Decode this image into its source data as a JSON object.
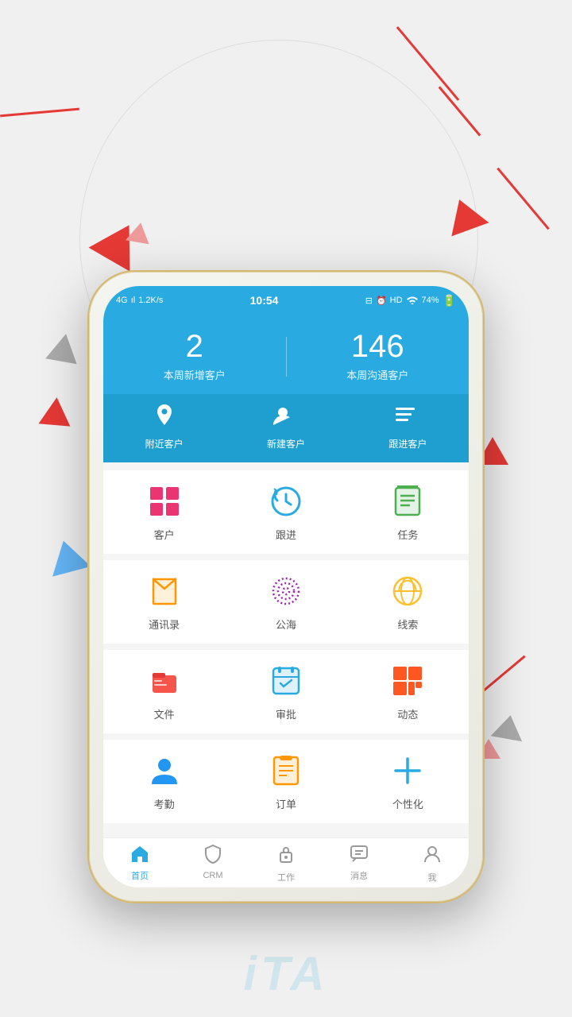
{
  "background": {
    "color": "#f0f0f0"
  },
  "status_bar": {
    "network": "4G",
    "signal": "ıl",
    "speed": "1.2K/s",
    "time": "10:54",
    "battery_icon": "□",
    "alarm": "⏰",
    "hd": "HD",
    "wifi": "wifi",
    "battery_pct": "74%"
  },
  "hero": {
    "stat1_number": "2",
    "stat1_label": "本周新增客户",
    "stat2_number": "146",
    "stat2_label": "本周沟通客户"
  },
  "quick_actions": [
    {
      "label": "附近客户",
      "icon": "location"
    },
    {
      "label": "新建客户",
      "icon": "add_person"
    },
    {
      "label": "跟进客户",
      "icon": "add_list"
    }
  ],
  "grid_rows": [
    {
      "items": [
        {
          "label": "客户",
          "icon": "grid",
          "color": "#e91e63"
        },
        {
          "label": "跟进",
          "icon": "refresh_clock",
          "color": "#29abe2"
        },
        {
          "label": "任务",
          "icon": "task_list",
          "color": "#4caf50"
        }
      ]
    },
    {
      "items": [
        {
          "label": "通讯录",
          "icon": "book",
          "color": "#ff9800"
        },
        {
          "label": "公海",
          "icon": "dots_circle",
          "color": "#9c27b0"
        },
        {
          "label": "线索",
          "icon": "globe",
          "color": "#fbc02d"
        }
      ]
    },
    {
      "items": [
        {
          "label": "文件",
          "icon": "briefcase",
          "color": "#f44336"
        },
        {
          "label": "审批",
          "icon": "calendar_check",
          "color": "#29abe2"
        },
        {
          "label": "动态",
          "icon": "grid4",
          "color": "#ff5722"
        }
      ]
    },
    {
      "items": [
        {
          "label": "考勤",
          "icon": "person_check",
          "color": "#2196f3"
        },
        {
          "label": "订单",
          "icon": "clipboard",
          "color": "#ff9800"
        },
        {
          "label": "个性化",
          "icon": "plus",
          "color": "#29abe2"
        }
      ]
    }
  ],
  "tab_bar": [
    {
      "label": "首页",
      "icon": "home",
      "active": true
    },
    {
      "label": "CRM",
      "icon": "shield",
      "active": false
    },
    {
      "label": "工作",
      "icon": "lock",
      "active": false
    },
    {
      "label": "消息",
      "icon": "chat",
      "active": false
    },
    {
      "label": "我",
      "icon": "person",
      "active": false
    }
  ],
  "app_logo": "iTA"
}
